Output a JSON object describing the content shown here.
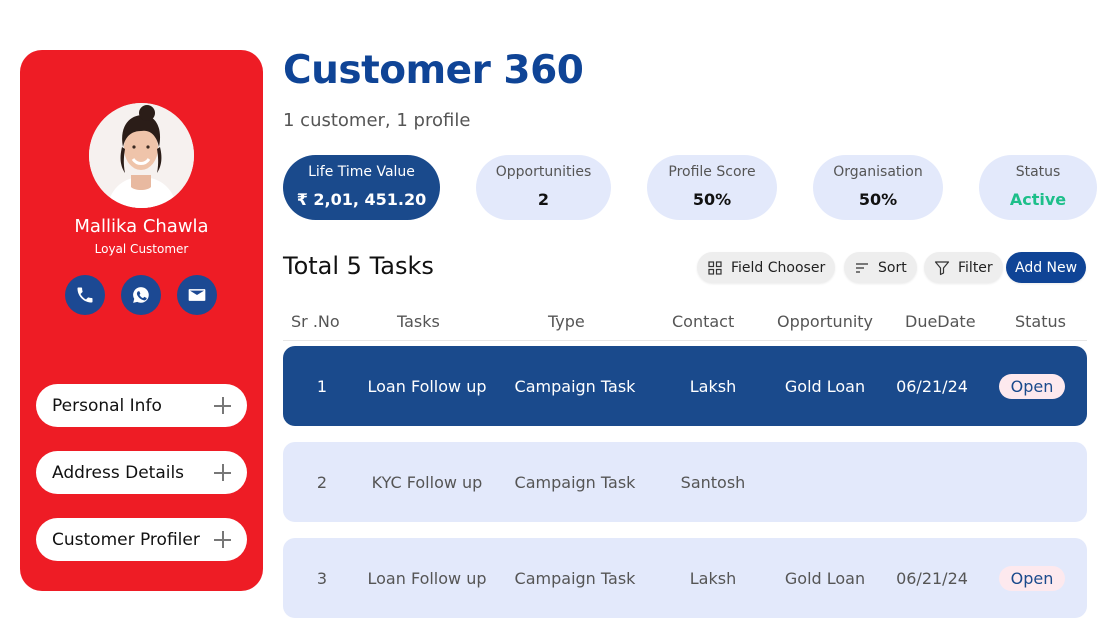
{
  "profile": {
    "name": "Mallika Chawla",
    "tag": "Loyal Customer",
    "actions": [
      {
        "icon": "phone-icon"
      },
      {
        "icon": "whatsapp-icon"
      },
      {
        "icon": "email-icon"
      }
    ],
    "sections": [
      {
        "label": "Personal Info"
      },
      {
        "label": "Address Details"
      },
      {
        "label": "Customer Profiler"
      }
    ]
  },
  "header": {
    "title": "Customer 360",
    "subtitle": "1 customer, 1 profile"
  },
  "stats": [
    {
      "label": "Life Time Value",
      "value": "₹ 2,01, 451.20"
    },
    {
      "label": "Opportunities",
      "value": "2"
    },
    {
      "label": "Profile Score",
      "value": "50%"
    },
    {
      "label": "Organisation",
      "value": "50%"
    },
    {
      "label": "Status",
      "value": "Active"
    }
  ],
  "tasks": {
    "heading": "Total  5 Tasks",
    "toolbar": {
      "field_chooser": "Field Chooser",
      "sort": "Sort",
      "filter": "Filter",
      "add_new": "Add New"
    },
    "columns": [
      "Sr .No",
      "Tasks",
      "Type",
      "Contact",
      "Opportunity",
      "DueDate",
      "Status"
    ],
    "rows": [
      {
        "sr": "1",
        "task": "Loan Follow up",
        "type": "Campaign Task",
        "contact": "Laksh",
        "opportunity": "Gold Loan",
        "due": "06/21/24",
        "status": "Open"
      },
      {
        "sr": "2",
        "task": "KYC Follow up",
        "type": "Campaign Task",
        "contact": "Santosh",
        "opportunity": "",
        "due": "",
        "status": ""
      },
      {
        "sr": "3",
        "task": "Loan Follow up",
        "type": "Campaign Task",
        "contact": "Laksh",
        "opportunity": "Gold Loan",
        "due": "06/21/24",
        "status": "Open"
      }
    ]
  },
  "colors": {
    "brand_red": "#ee1c25",
    "brand_blue": "#0f4496",
    "selected_row": "#1a4a8c",
    "row_bg": "#e3e9fb",
    "active_green": "#1dbf8a"
  }
}
